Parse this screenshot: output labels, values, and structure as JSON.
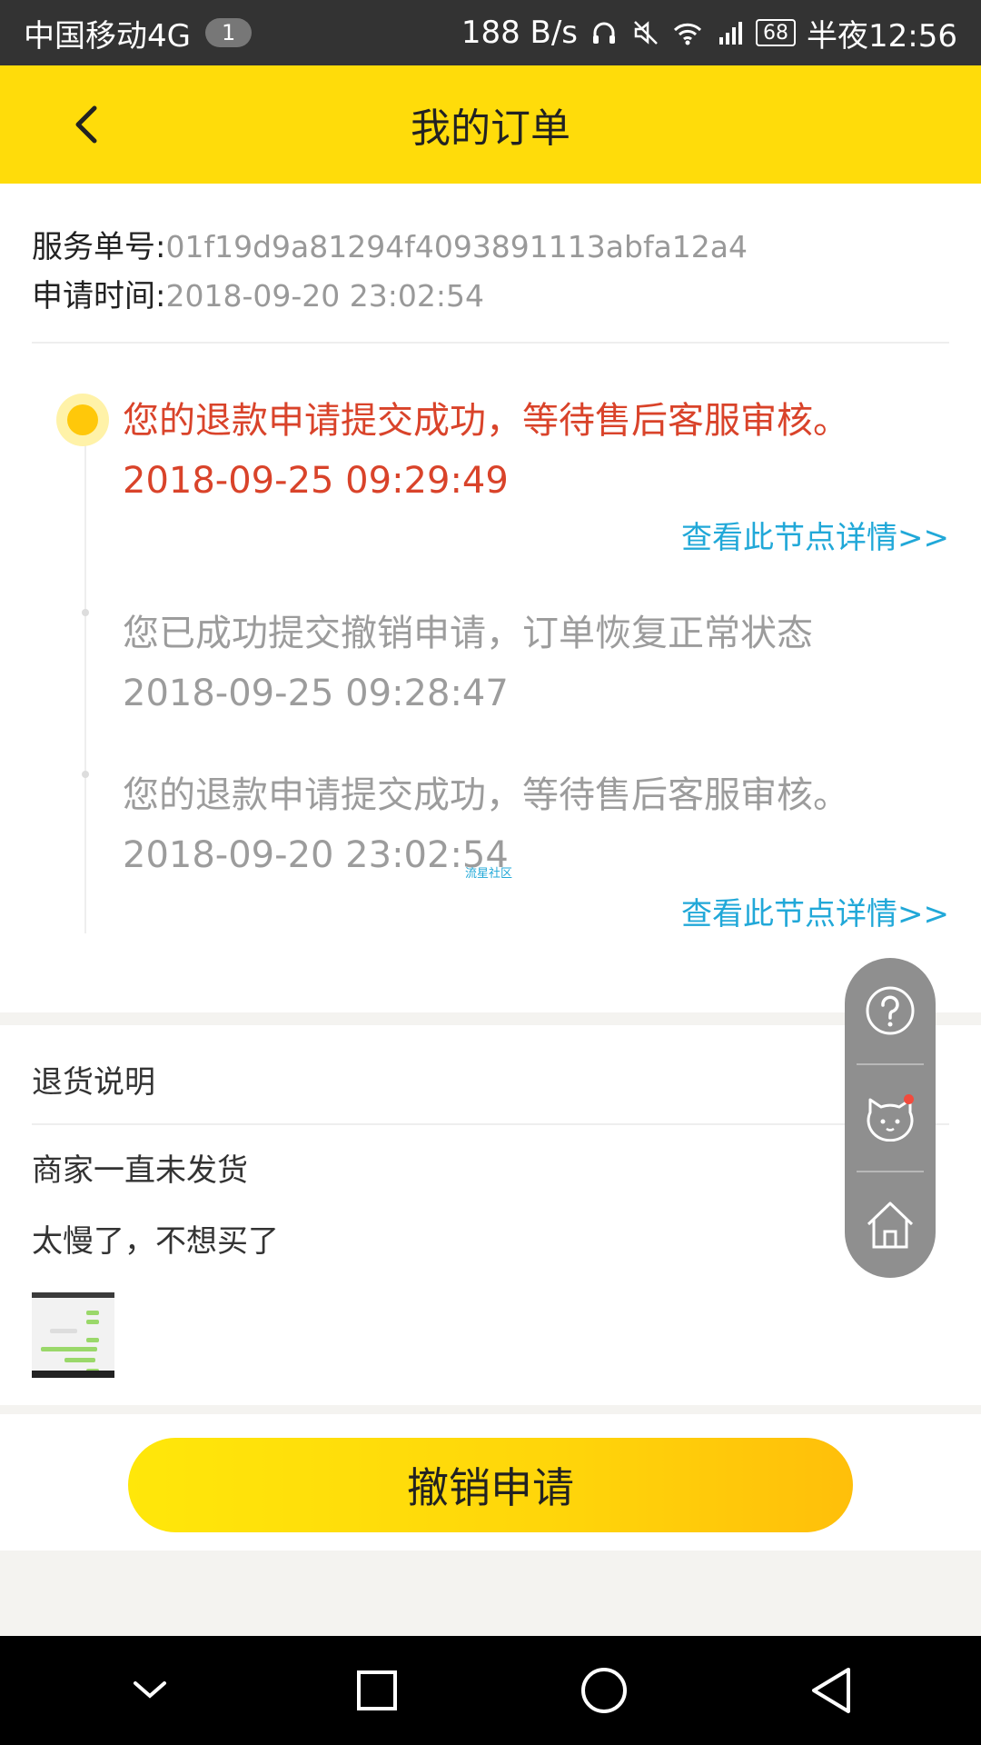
{
  "status_bar": {
    "carrier": "中国移动4G",
    "notif_count": "1",
    "speed": "188 B/s",
    "battery": "68",
    "time": "半夜12:56"
  },
  "header": {
    "title": "我的订单"
  },
  "order": {
    "service_label": "服务单号:",
    "service_no": "01f19d9a81294f4093891113abfa12a4",
    "apply_label": "申请时间:",
    "apply_time": "2018-09-20 23:02:54"
  },
  "timeline": [
    {
      "text": "您的退款申请提交成功，等待售后客服审核。",
      "time": "2018-09-25 09:29:49",
      "link": "查看此节点详情>>"
    },
    {
      "text": "您已成功提交撤销申请，订单恢复正常状态",
      "time": "2018-09-25 09:28:47"
    },
    {
      "text": "您的退款申请提交成功，等待售后客服审核。",
      "time": "2018-09-20 23:02:54",
      "link": "查看此节点详情>>"
    }
  ],
  "watermark": "流星社区",
  "explanation": {
    "title": "退货说明",
    "lines": [
      "商家一直未发货",
      "太慢了，不想买了"
    ]
  },
  "action": {
    "cancel_label": "撤销申请"
  },
  "colors": {
    "brand_yellow": "#ffdc0a",
    "active_red": "#d9432a",
    "link_blue": "#21a8d8"
  }
}
